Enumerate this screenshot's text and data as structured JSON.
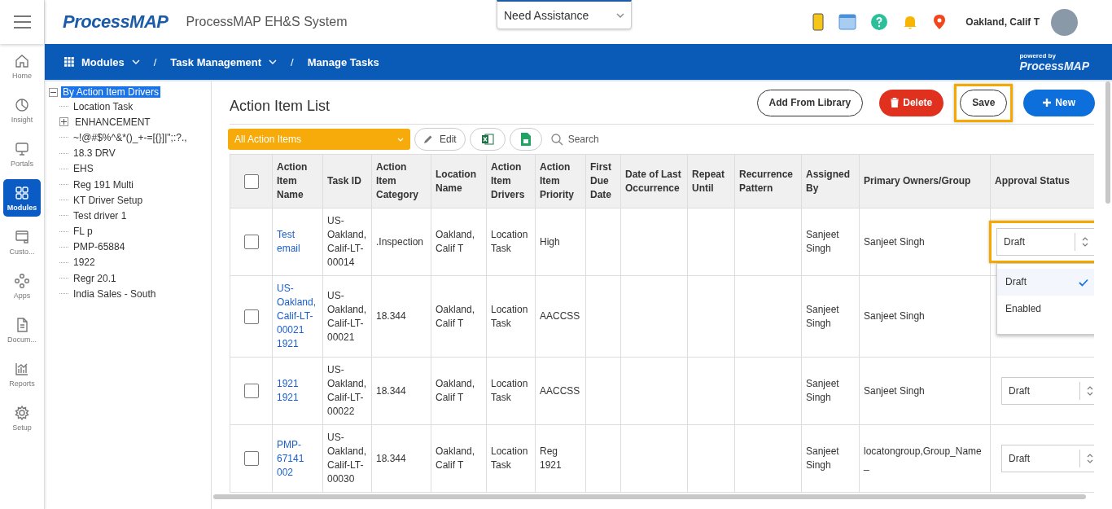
{
  "header": {
    "logo": "ProcessMAP",
    "app_title": "ProcessMAP EH&S System",
    "assistance": "Need Assistance",
    "user_name": "Oakland, Calif T"
  },
  "rail": [
    {
      "label": "Home",
      "selected": false
    },
    {
      "label": "Insight",
      "selected": false
    },
    {
      "label": "Portals",
      "selected": false
    },
    {
      "label": "Modules",
      "selected": true
    },
    {
      "label": "Custo...",
      "selected": false
    },
    {
      "label": "Apps",
      "selected": false
    },
    {
      "label": "Docum...",
      "selected": false
    },
    {
      "label": "Reports",
      "selected": false
    },
    {
      "label": "Setup",
      "selected": false
    }
  ],
  "breadcrumb": {
    "separator": "/",
    "items": [
      {
        "label": "Modules",
        "dropdown": true
      },
      {
        "label": "Task Management",
        "dropdown": true
      },
      {
        "label": "Manage Tasks",
        "dropdown": false
      }
    ]
  },
  "powered_by": {
    "caption": "powered by",
    "logo": "ProcessMAP"
  },
  "tree": {
    "label": "By Action Item Drivers",
    "selected": true,
    "expanded": true,
    "children": [
      {
        "label": "Location Task",
        "expandable": false
      },
      {
        "label": "ENHANCEMENT",
        "expandable": true
      },
      {
        "label": "~!@#$%^&*()_+-=[{}]|\";:?.,",
        "expandable": false
      },
      {
        "label": "18.3 DRV",
        "expandable": false
      },
      {
        "label": "EHS",
        "expandable": false
      },
      {
        "label": "Reg 191 Multi",
        "expandable": false
      },
      {
        "label": "KT Driver Setup",
        "expandable": false
      },
      {
        "label": "Test driver 1",
        "expandable": false
      },
      {
        "label": "FL p",
        "expandable": false
      },
      {
        "label": "PMP-65884",
        "expandable": false
      },
      {
        "label": "1922",
        "expandable": false
      },
      {
        "label": "Regr 20.1",
        "expandable": false
      },
      {
        "label": "India Sales - South",
        "expandable": false
      }
    ]
  },
  "list_title": "Action Item List",
  "actions": [
    {
      "kind": "outline",
      "label": "Add From Library",
      "highlighted": false
    },
    {
      "kind": "delete",
      "label": "Delete",
      "highlighted": false
    },
    {
      "kind": "outline",
      "label": "Save",
      "highlighted": true
    },
    {
      "kind": "new",
      "label": "New",
      "highlighted": false
    }
  ],
  "toolbar": {
    "filter": "All Action Items",
    "edit": "Edit",
    "search": "Search"
  },
  "table": {
    "all_checked": false,
    "columns": [
      "Action Item Name",
      "Task ID",
      "Action Item Category",
      "Location Name",
      "Action Item Drivers",
      "Action Item Priority",
      "First Due Date",
      "Date of Last Occurrence",
      "Repeat Until",
      "Recurrence Pattern",
      "Assigned By",
      "Primary Owners/Group",
      "Approval Status"
    ],
    "rows": [
      {
        "checked": false,
        "cells": [
          "Test email",
          "US-Oakland, Calif-LT-00014",
          ".Inspection",
          "Oakland, Calif T",
          "Location Task",
          "High",
          "",
          "",
          "",
          "",
          "Sanjeet Singh",
          "Sanjeet Singh"
        ],
        "status": "Draft",
        "highlighted": true,
        "menu": [
          {
            "label": "Draft",
            "selected": true
          },
          {
            "label": "Enabled",
            "selected": false
          }
        ]
      },
      {
        "checked": false,
        "cells": [
          "US-Oakland, Calif-LT-00021 1921",
          "US-Oakland, Calif-LT-00021",
          "18.344",
          "Oakland, Calif T",
          "Location Task",
          "AACCSS",
          "",
          "",
          "",
          "",
          "Sanjeet Singh",
          "Sanjeet Singh"
        ],
        "highlighted": false
      },
      {
        "checked": false,
        "cells": [
          "1921 1921",
          "US-Oakland, Calif-LT-00022",
          "18.344",
          "Oakland, Calif T",
          "Location Task",
          "AACCSS",
          "",
          "",
          "",
          "",
          "Sanjeet Singh",
          "Sanjeet Singh"
        ],
        "status": "Draft",
        "highlighted": false
      },
      {
        "checked": false,
        "cells": [
          "PMP-67141 002",
          "US-Oakland, Calif-LT-00030",
          "18.344",
          "Oakland, Calif T",
          "Location Task",
          "Reg 1921",
          "",
          "",
          "",
          "",
          "Sanjeet Singh",
          "locatongroup,Group_Name_"
        ],
        "status": "Draft",
        "highlighted": false
      }
    ]
  }
}
